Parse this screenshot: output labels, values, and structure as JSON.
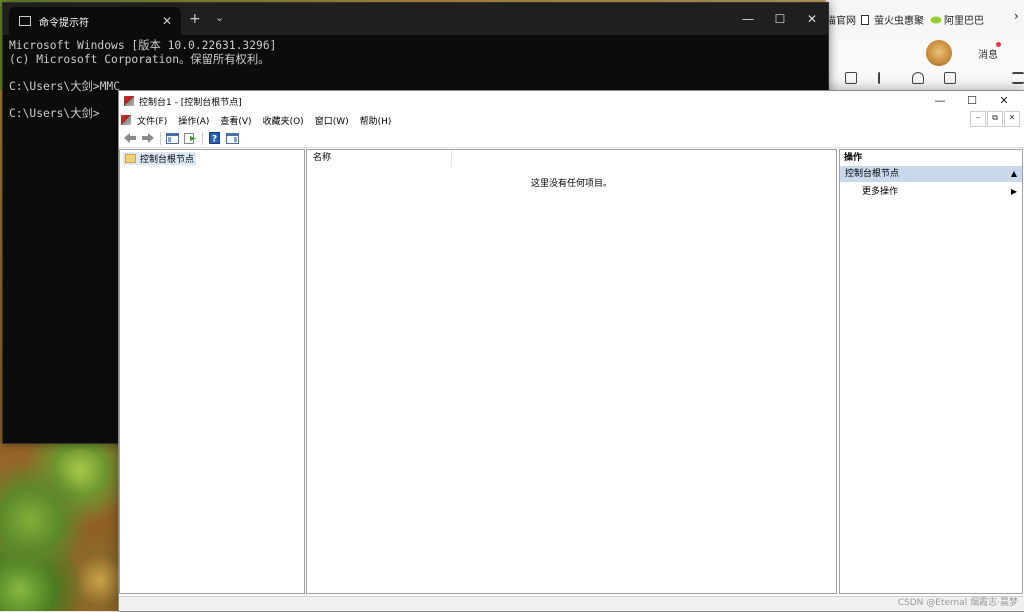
{
  "browser": {
    "bookmarks": [
      {
        "label": "猫官网",
        "icon": "page-icon"
      },
      {
        "label": "萤火虫惠聚",
        "icon": "page-icon"
      },
      {
        "label": "阿里巴巴",
        "icon": "leaf-icon"
      }
    ],
    "more_chevron": "›",
    "messages_label": "消息"
  },
  "terminal": {
    "tab_title": "命令提示符",
    "tab_close": "✕",
    "new_tab": "+",
    "dropdown": "⌄",
    "minimize": "—",
    "maximize": "☐",
    "close": "✕",
    "lines": [
      "Microsoft Windows [版本 10.0.22631.3296]",
      "(c) Microsoft Corporation。保留所有权利。",
      "",
      "C:\\Users\\大剑>MMC",
      "",
      "C:\\Users\\大剑>"
    ]
  },
  "mmc": {
    "title": "控制台1 - [控制台根节点]",
    "minimize": "—",
    "maximize": "☐",
    "close": "✕",
    "menu": [
      "文件(F)",
      "操作(A)",
      "查看(V)",
      "收藏夹(O)",
      "窗口(W)",
      "帮助(H)"
    ],
    "mdi_minimize": "–",
    "mdi_restore": "⧉",
    "mdi_close": "✕",
    "toolbar": {
      "back": "🡐",
      "forward": "🡒",
      "help": "?"
    },
    "tree_root": "控制台根节点",
    "column_name": "名称",
    "empty_message": "这里没有任何项目。",
    "actions_header": "操作",
    "actions_section": "控制台根节点",
    "actions_section_toggle": "▲",
    "more_actions": "更多操作",
    "more_actions_arrow": "▶"
  },
  "watermark": "CSDN @Eternal 烟霞志·晨梦"
}
